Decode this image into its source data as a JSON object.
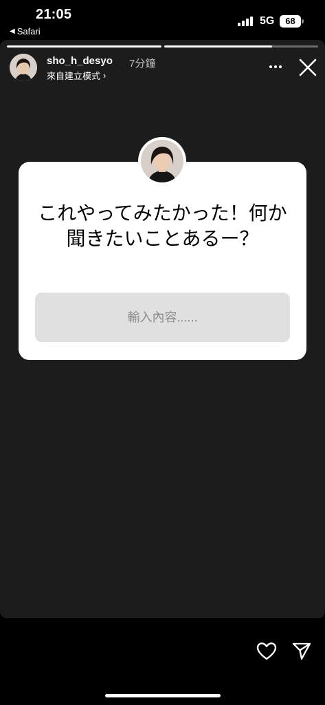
{
  "status_bar": {
    "time": "21:05",
    "back_app": "Safari",
    "network": "5G",
    "battery": "68"
  },
  "story": {
    "progress": [
      1.0,
      0.7
    ],
    "username": "sho_h_desyo",
    "time_ago": "7分鐘",
    "subtitle": "來自建立模式",
    "subtitle_chevron": "›"
  },
  "question_sticker": {
    "question": "これやってみたかった！何か聞きたいことあるー？",
    "input_placeholder": "輸入內容......"
  },
  "icons": {
    "more": "more-horizontal-icon",
    "close": "close-icon",
    "like": "heart-icon",
    "share": "send-icon"
  }
}
